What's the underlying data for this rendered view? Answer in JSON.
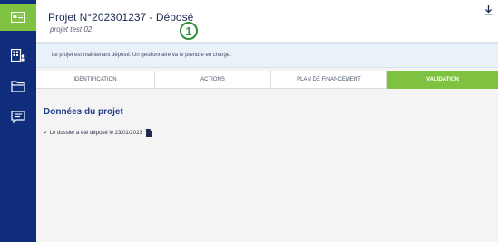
{
  "header": {
    "title": "Projet N°202301237 - Déposé",
    "subtitle": "projet test 02",
    "step_number": "1",
    "small_text": "..."
  },
  "banner": {
    "message": "Le projet est maintenant déposé. Un gestionnaire va le prendre en charge."
  },
  "tabs": [
    {
      "label": "IDENTIFICATION",
      "active": false
    },
    {
      "label": "ACTIONS",
      "active": false
    },
    {
      "label": "PLAN DE FINANCEMENT",
      "active": false
    },
    {
      "label": "VALIDATION",
      "active": true
    }
  ],
  "content": {
    "section_title": "Données du projet",
    "status_text": "✓ Le dossier a été déposé le 23/01/2023"
  },
  "sidebar": {
    "items": [
      {
        "icon": "id-card-icon",
        "active": true
      },
      {
        "icon": "building-person-icon",
        "active": false
      },
      {
        "icon": "folder-icon",
        "active": false
      },
      {
        "icon": "chat-document-icon",
        "active": false
      }
    ]
  },
  "colors": {
    "sidebar": "#0f2d7a",
    "accent_green": "#7fc242",
    "badge_green": "#2f8f3a",
    "title_blue": "#1f3a8a",
    "banner_bg": "#eaf2f9"
  }
}
